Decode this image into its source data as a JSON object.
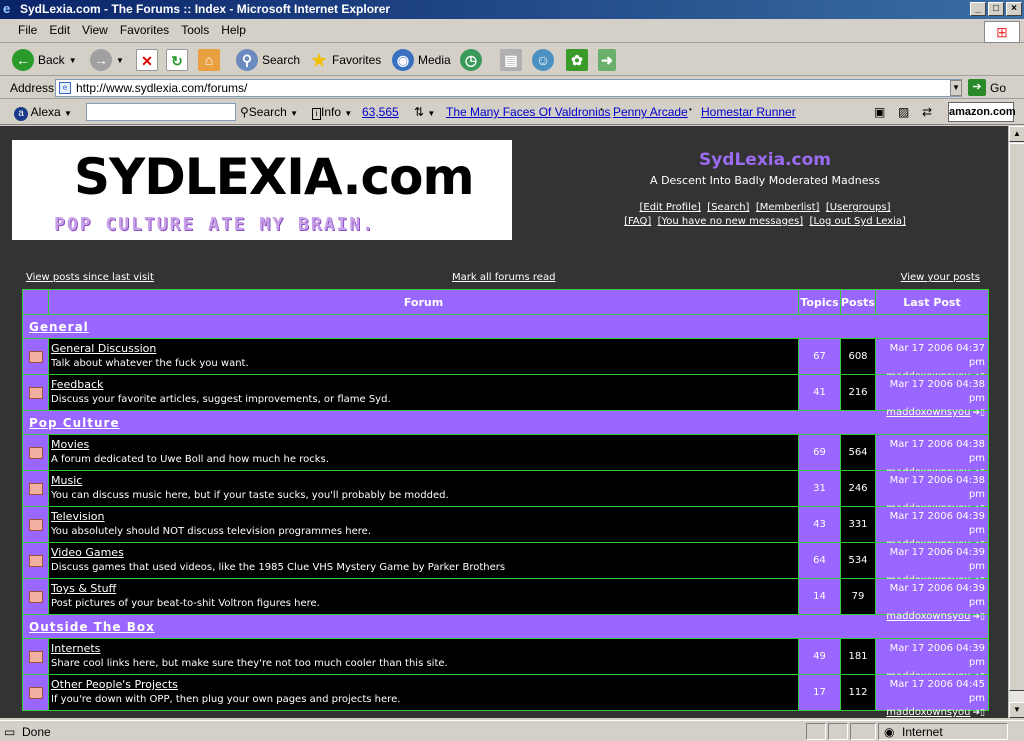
{
  "window": {
    "title": "SydLexia.com - The Forums :: Index - Microsoft Internet Explorer",
    "buttons": [
      "_",
      "□",
      "×"
    ]
  },
  "menu": [
    "File",
    "Edit",
    "View",
    "Favorites",
    "Tools",
    "Help"
  ],
  "toolbar": {
    "back": "Back",
    "search": "Search",
    "favorites": "Favorites",
    "media": "Media"
  },
  "address": {
    "label": "Address",
    "url": "http://www.sydlexia.com/forums/",
    "go": "Go"
  },
  "alexa": {
    "brand": "Alexa",
    "search": "Search",
    "info": "Info",
    "rank": "63,565",
    "links": [
      "The Many Faces Of Valdronius",
      "Penny Arcade",
      "Homestar Runner"
    ],
    "amazon": "amazon.com"
  },
  "site": {
    "logo_text": "SYDLEXIA.com",
    "tagline": "POP CULTURE ATE MY BRAIN.",
    "name": "SydLexia.com",
    "description": "A Descent Into Badly Moderated Madness",
    "links_row1": [
      "[Edit Profile]",
      "[Search]",
      "[Memberlist]",
      "[Usergroups]"
    ],
    "links_row2": [
      "[FAQ]",
      "[You have no new messages]",
      "[Log out Syd Lexia]"
    ]
  },
  "toplinks": {
    "left": "View posts since last visit",
    "center": "Mark all forums read",
    "right": "View your posts"
  },
  "table_headers": {
    "forum": "Forum",
    "topics": "Topics",
    "posts": "Posts",
    "last_post": "Last Post"
  },
  "categories": [
    {
      "name": "General",
      "forums": [
        {
          "title": "General Discussion",
          "desc": "Talk about whatever the fuck you want.",
          "topics": "67",
          "posts": "608",
          "last_date": "Mar 17 2006 04:37 pm",
          "last_user": "maddoxownsyou"
        },
        {
          "title": "Feedback",
          "desc": "Discuss your favorite articles, suggest improvements, or flame Syd.",
          "topics": "41",
          "posts": "216",
          "last_date": "Mar 17 2006 04:38 pm",
          "last_user": "maddoxownsyou"
        }
      ]
    },
    {
      "name": "Pop Culture",
      "forums": [
        {
          "title": "Movies",
          "desc": "A forum dedicated to Uwe Boll and how much he rocks.",
          "topics": "69",
          "posts": "564",
          "last_date": "Mar 17 2006 04:38 pm",
          "last_user": "maddoxownsyou"
        },
        {
          "title": "Music",
          "desc": "You can discuss music here, but if your taste sucks, you'll probably be modded.",
          "topics": "31",
          "posts": "246",
          "last_date": "Mar 17 2006 04:38 pm",
          "last_user": "maddoxownsyou"
        },
        {
          "title": "Television",
          "desc": "You absolutely should NOT discuss television programmes here.",
          "topics": "43",
          "posts": "331",
          "last_date": "Mar 17 2006 04:39 pm",
          "last_user": "maddoxownsyou"
        },
        {
          "title": "Video Games",
          "desc": "Discuss games that used videos, like the 1985 Clue VHS Mystery Game by Parker Brothers",
          "topics": "64",
          "posts": "534",
          "last_date": "Mar 17 2006 04:39 pm",
          "last_user": "maddoxownsyou"
        },
        {
          "title": "Toys & Stuff",
          "desc": "Post pictures of your beat-to-shit Voltron figures here.",
          "topics": "14",
          "posts": "79",
          "last_date": "Mar 17 2006 04:39 pm",
          "last_user": "maddoxownsyou"
        }
      ]
    },
    {
      "name": "Outside The Box",
      "forums": [
        {
          "title": "Internets",
          "desc": "Share cool links here, but make sure they're not too much cooler than this site.",
          "topics": "49",
          "posts": "181",
          "last_date": "Mar 17 2006 04:39 pm",
          "last_user": "maddoxownsyou"
        },
        {
          "title": "Other People's Projects",
          "desc": "If you're down with OPP, then plug your own pages and projects here.",
          "topics": "17",
          "posts": "112",
          "last_date": "Mar 17 2006 04:45 pm",
          "last_user": "maddoxownsyou"
        }
      ]
    }
  ],
  "status": {
    "text": "Done",
    "zone": "Internet"
  }
}
